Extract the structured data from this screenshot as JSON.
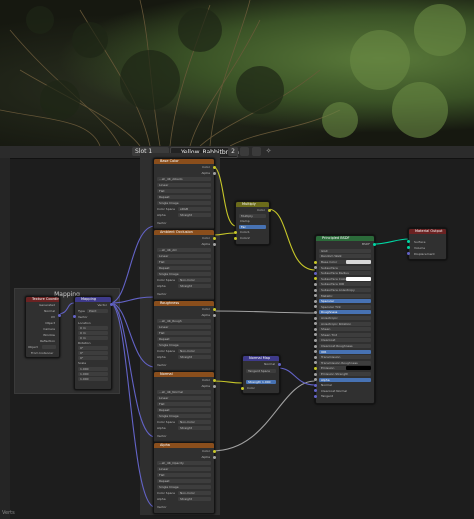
{
  "header": {
    "slot": "Slot 1",
    "material_name": "Yellow_Rabbitbrush",
    "users": "2"
  },
  "frames": {
    "mapping_title": "Mapping"
  },
  "nodes": {
    "texcoord": {
      "title": "Texture Coordinate",
      "outputs": [
        "Generated",
        "Normal",
        "UV",
        "Object",
        "Camera",
        "Window",
        "Reflection"
      ],
      "object_label": "Object",
      "from_instancer": "From Instancer"
    },
    "mapping": {
      "title": "Mapping",
      "out": "Vector",
      "type_label": "Type",
      "type_value": "Point",
      "vector": "Vector",
      "location": "Location",
      "rotation": "Rotation",
      "scale": "Scale",
      "vals": [
        "0 m",
        "0 m",
        "0 m",
        "0°",
        "0°",
        "0°",
        "1.000",
        "1.000",
        "1.000"
      ]
    },
    "tex1": {
      "title": "Base Color",
      "image": "...sh_4K_Albedo",
      "opts": [
        "Linear",
        "Flat",
        "Repeat",
        "Single Image",
        "Color Space",
        "Alpha"
      ],
      "color_space": "sRGB",
      "alpha": "Straight",
      "vector": "Vector",
      "outs": [
        "Color",
        "Alpha"
      ]
    },
    "tex2": {
      "title": "Ambient Occlusion",
      "image": "...sh_4K_AO",
      "opts": [
        "Linear",
        "Flat",
        "Repeat",
        "Single Image",
        "Color Space",
        "Alpha"
      ],
      "color_space": "Non-Color",
      "alpha": "Straight",
      "vector": "Vector",
      "outs": [
        "Color",
        "Alpha"
      ]
    },
    "tex3": {
      "title": "Roughness",
      "image": "...sh_4K_Rough",
      "opts": [
        "Linear",
        "Flat",
        "Repeat",
        "Single Image",
        "Color Space",
        "Alpha"
      ],
      "color_space": "Non-Color",
      "alpha": "Straight",
      "vector": "Vector",
      "outs": [
        "Color",
        "Alpha"
      ]
    },
    "tex4": {
      "title": "Normal",
      "image": "...sh_4K_Normal",
      "opts": [
        "Linear",
        "Flat",
        "Repeat",
        "Single Image",
        "Color Space",
        "Alpha"
      ],
      "color_space": "Non-Color",
      "alpha": "Straight",
      "vector": "Vector",
      "outs": [
        "Color",
        "Alpha"
      ]
    },
    "tex5": {
      "title": "Alpha",
      "image": "...sh_4K_Opacity",
      "opts": [
        "Linear",
        "Flat",
        "Repeat",
        "Single Image",
        "Color Space",
        "Alpha"
      ],
      "color_space": "Non-Color",
      "alpha": "Straight",
      "vector": "Vector",
      "outs": [
        "Color",
        "Alpha"
      ]
    },
    "mix": {
      "title": "Multiply",
      "out": "Color",
      "opts": [
        "Multiply",
        "Clamp"
      ],
      "fac": "Fac",
      "c1": "Color1",
      "c2": "Color2"
    },
    "bsdf": {
      "title": "Principled BSDF",
      "out": "BSDF",
      "opts": [
        "GGX",
        "Random Walk"
      ],
      "inputs": [
        "Base Color",
        "Subsurface",
        "Subsurface Radius",
        "Subsurface Color",
        "Subsurface IOR",
        "Subsurface Anisotropy",
        "Metallic",
        "Specular",
        "Specular Tint",
        "Roughness",
        "Anisotropic",
        "Anisotropic Rotation",
        "Sheen",
        "Sheen Tint",
        "Clearcoat",
        "Clearcoat Roughness",
        "IOR",
        "Transmission",
        "Transmission Roughness",
        "Emission",
        "Emission Strength",
        "Alpha",
        "Normal",
        "Clearcoat Normal",
        "Tangent"
      ]
    },
    "normalmap": {
      "title": "Normal Map",
      "out": "Normal",
      "space": "Tangent Space",
      "strength": "Strength",
      "strength_val": "1.000",
      "color": "Color"
    },
    "output": {
      "title": "Material Output",
      "inputs": [
        "Surface",
        "Volume",
        "Displacement"
      ]
    }
  },
  "footer": {
    "corner": "Verts"
  },
  "colors": {
    "image_texture_header": "#8a4e1c",
    "color_header": "#6b6b1a",
    "shader_header": "#2b6b3a",
    "output_header": "#6b2222",
    "vector_header": "#3e3a8a",
    "link_yellow": "#c7c729",
    "link_purple": "#6363c7",
    "link_gray": "#a1a1a1",
    "link_green": "#00d6a3"
  }
}
